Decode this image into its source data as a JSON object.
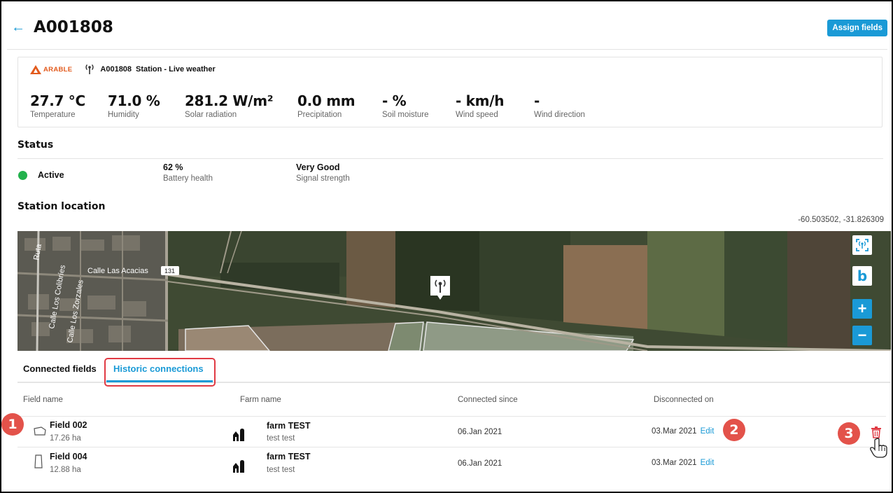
{
  "header": {
    "title": "A001808",
    "assign_label": "Assign fields"
  },
  "station": {
    "brand": "ARABLE",
    "id": "A001808",
    "type": "Station - Live weather",
    "metrics": [
      {
        "value": "27.7 °C",
        "label": "Temperature"
      },
      {
        "value": "71.0 %",
        "label": "Humidity"
      },
      {
        "value": "281.2 W/m²",
        "label": "Solar radiation"
      },
      {
        "value": "0.0 mm",
        "label": "Precipitation"
      },
      {
        "value": "- %",
        "label": "Soil moisture"
      },
      {
        "value": "- km/h",
        "label": "Wind speed"
      },
      {
        "value": "-",
        "label": "Wind direction"
      }
    ]
  },
  "status": {
    "heading": "Status",
    "state": "Active",
    "state_color": "#22b14c",
    "battery_value": "62 %",
    "battery_label": "Battery health",
    "signal_value": "Very Good",
    "signal_label": "Signal strength"
  },
  "location": {
    "heading": "Station location",
    "coords": "-60.503502, -31.826309",
    "map_labels": {
      "road": "Ruta",
      "street1": "Calle Las Acacias",
      "street2": "Calle Los Colibríes",
      "street3": "Calle Los Zorzales",
      "route": "131"
    },
    "controls": [
      "locate-icon",
      "bing-icon",
      "zoom-in-icon",
      "zoom-out-icon"
    ],
    "zoom_in": "+",
    "zoom_out": "−",
    "bing": "b"
  },
  "tabs": {
    "connected": "Connected fields",
    "historic": "Historic connections"
  },
  "table": {
    "columns": [
      "Field name",
      "Farm name",
      "Connected since",
      "Disconnected on"
    ],
    "rows": [
      {
        "field": "Field 002",
        "area": "17.26 ha",
        "farm": "farm TEST",
        "farm_sub": "test test",
        "since": "06.Jan 2021",
        "disconnected": "03.Mar 2021",
        "edit": "Edit"
      },
      {
        "field": "Field 004",
        "area": "12.88 ha",
        "farm": "farm TEST",
        "farm_sub": "test test",
        "since": "06.Jan 2021",
        "disconnected": "03.Mar 2021",
        "edit": "Edit"
      }
    ]
  },
  "callouts": [
    "1",
    "2",
    "3"
  ],
  "colors": {
    "accent": "#1a9ad6",
    "callout": "#e3524a",
    "delete": "#e03a43"
  }
}
